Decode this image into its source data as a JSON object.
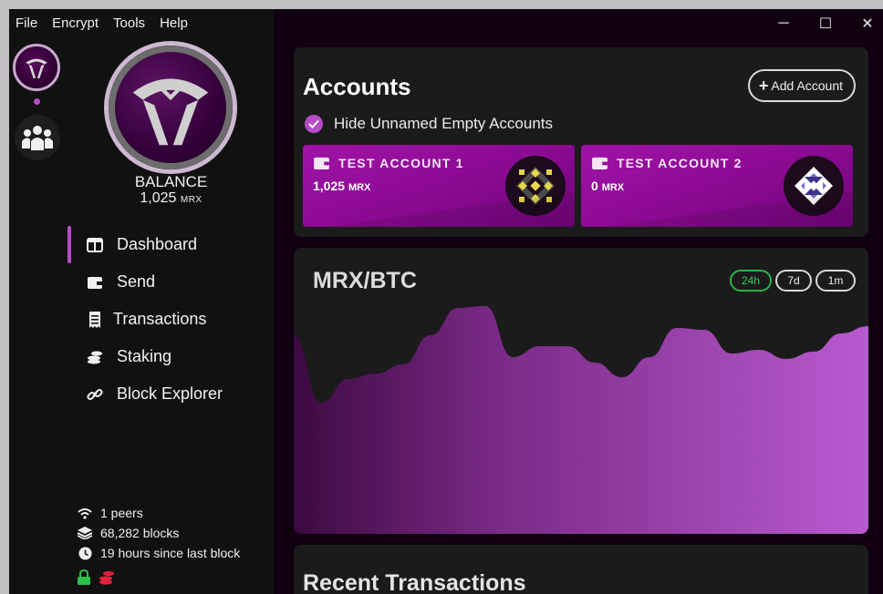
{
  "menu": [
    "File",
    "Encrypt",
    "Tools",
    "Help"
  ],
  "window_controls": {
    "minimize": "─",
    "maximize": "☐",
    "close": "✕"
  },
  "sidebar": {
    "balance_label": "BALANCE",
    "balance_amount": "1,025",
    "balance_unit": "MRX",
    "nav": [
      {
        "label": "Dashboard",
        "icon": "dashboard-icon",
        "active": true
      },
      {
        "label": "Send",
        "icon": "wallet-icon",
        "active": false
      },
      {
        "label": "Transactions",
        "icon": "receipt-icon",
        "active": false
      },
      {
        "label": "Staking",
        "icon": "coins-icon",
        "active": false
      },
      {
        "label": "Block Explorer",
        "icon": "link-icon",
        "active": false
      }
    ],
    "status": {
      "peers": "1 peers",
      "blocks": "68,282 blocks",
      "last_block": "19 hours since last block"
    }
  },
  "accounts": {
    "title": "Accounts",
    "add_label": "Add Account",
    "hide_label": "Hide Unnamed Empty Accounts",
    "hide_checked": true,
    "items": [
      {
        "name": "TEST ACCOUNT 1",
        "amount": "1,025",
        "unit": "MRX"
      },
      {
        "name": "TEST ACCOUNT 2",
        "amount": "0",
        "unit": "MRX"
      }
    ]
  },
  "price_chart": {
    "title": "MRX/BTC",
    "ranges": [
      {
        "label": "24h",
        "active": true
      },
      {
        "label": "7d",
        "active": false
      },
      {
        "label": "1m",
        "active": false
      }
    ],
    "values": [
      52,
      15,
      28,
      31,
      36,
      52,
      67,
      68,
      40,
      46,
      46,
      37,
      29,
      40,
      56,
      55,
      42,
      44,
      39,
      43,
      53,
      57
    ]
  },
  "recent": {
    "title": "Recent Transactions"
  },
  "colors": {
    "accent": "#b64cc7",
    "account_card": "#9b11a3",
    "active_range": "#28b44a"
  }
}
